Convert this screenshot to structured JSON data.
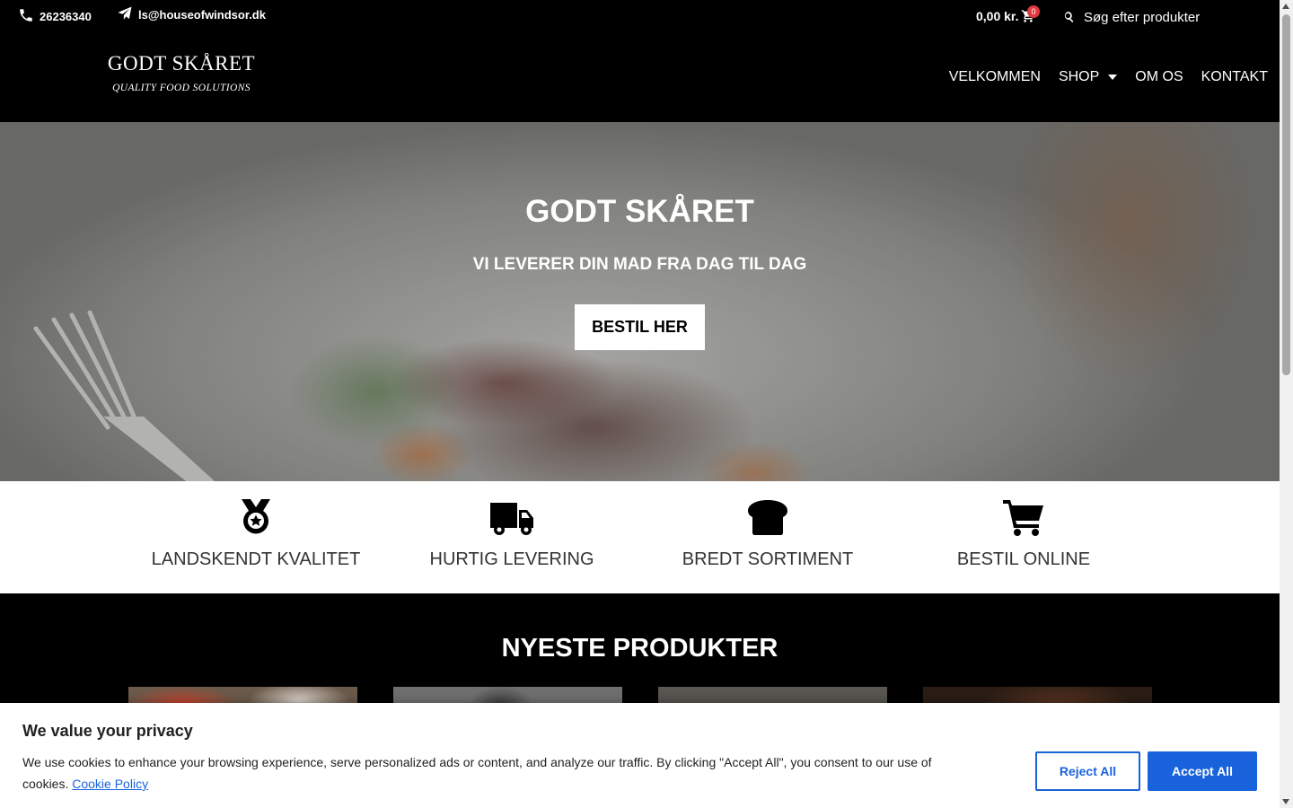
{
  "topbar": {
    "phone": "26236340",
    "phone_icon": "phone-icon",
    "email": "ls@houseofwindsor.dk",
    "email_icon": "paper-plane-icon",
    "cart_total": "0,00 kr.",
    "cart_count": "0",
    "cart_icon": "cart-icon",
    "search_icon": "search-icon",
    "search_placeholder": "Søg efter produkter"
  },
  "logo": {
    "title": "GODT SKÅRET",
    "subtitle": "QUALITY FOOD SOLUTIONS"
  },
  "nav": {
    "items": [
      {
        "label": "VELKOMMEN"
      },
      {
        "label": "SHOP",
        "has_dropdown": true
      },
      {
        "label": "OM OS"
      },
      {
        "label": "KONTAKT"
      }
    ]
  },
  "hero": {
    "title": "GODT SKÅRET",
    "subtitle": "VI LEVERER DIN MAD FRA DAG TIL DAG",
    "button_label": "BESTIL HER"
  },
  "features": [
    {
      "icon": "medal-icon",
      "label": "LANDSKENDT KVALITET"
    },
    {
      "icon": "truck-icon",
      "label": "HURTIG LEVERING"
    },
    {
      "icon": "bread-icon",
      "label": "BREDT SORTIMENT"
    },
    {
      "icon": "shopping-cart-icon",
      "label": "BESTIL ONLINE"
    }
  ],
  "products": {
    "title": "NYESTE PRODUKTER"
  },
  "cookie": {
    "title": "We value your privacy",
    "text": "We use cookies to enhance your browsing experience, serve personalized ads or content, and analyze our traffic. By clicking \"Accept All\", you consent to our use of cookies.",
    "link_label": "Cookie Policy",
    "reject_label": "Reject All",
    "accept_label": "Accept All"
  },
  "colors": {
    "accent_blue": "#1863dc",
    "badge_red": "#e0383e",
    "header_bg": "#000000",
    "features_bg": "#ffffff"
  }
}
